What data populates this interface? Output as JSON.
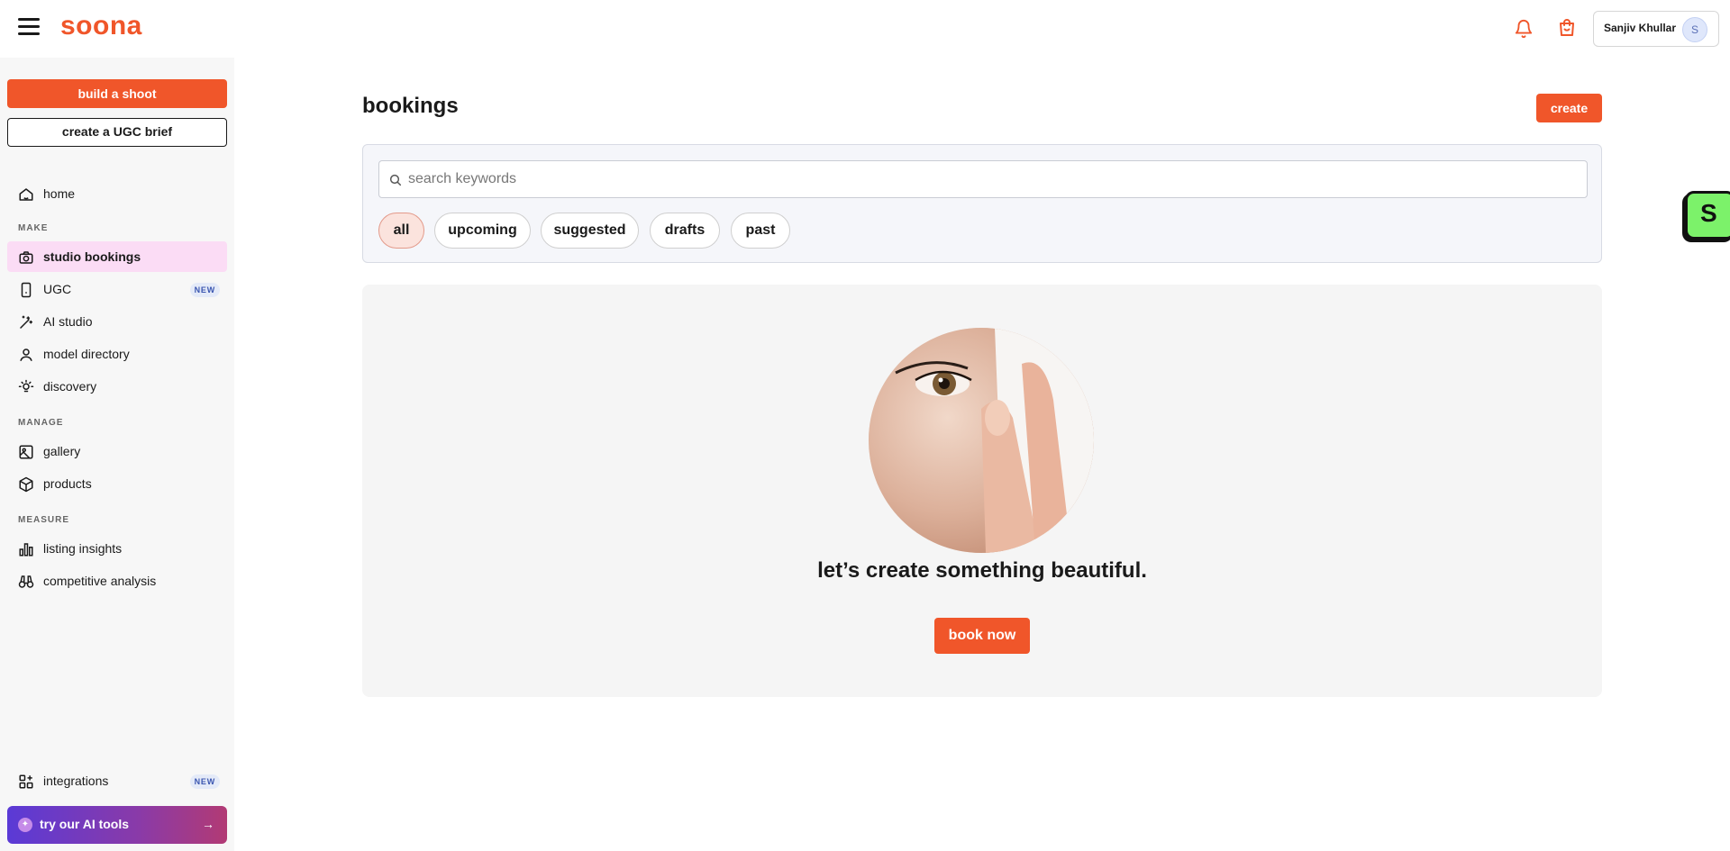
{
  "app": {
    "logo": "soona"
  },
  "header": {
    "user_name": "Sanjiv Khullar",
    "avatar_initial": "S"
  },
  "sidebar": {
    "build_shoot": "build a shoot",
    "create_ugc": "create a UGC brief",
    "home": "home",
    "sections": {
      "make": "MAKE",
      "manage": "MANAGE",
      "measure": "MEASURE"
    },
    "make_items": [
      {
        "label": "studio bookings",
        "active": true
      },
      {
        "label": "UGC",
        "badge": "NEW"
      },
      {
        "label": "AI studio"
      },
      {
        "label": "model directory"
      },
      {
        "label": "discovery"
      }
    ],
    "manage_items": [
      {
        "label": "gallery"
      },
      {
        "label": "products"
      }
    ],
    "measure_items": [
      {
        "label": "listing insights"
      },
      {
        "label": "competitive analysis"
      }
    ],
    "integrations": {
      "label": "integrations",
      "badge": "NEW"
    },
    "ai_tools": "try our AI tools"
  },
  "main": {
    "title": "bookings",
    "create_label": "create",
    "search": {
      "placeholder": "search keywords",
      "value": ""
    },
    "filters": [
      {
        "label": "all",
        "selected": true
      },
      {
        "label": "upcoming"
      },
      {
        "label": "suggested"
      },
      {
        "label": "drafts"
      },
      {
        "label": "past"
      }
    ],
    "empty_state": {
      "heading": "let’s create something beautiful.",
      "button": "book now"
    }
  },
  "side_widget": {
    "letter": "S"
  },
  "colors": {
    "accent": "#f0562a",
    "active_nav": "#fbdcf5",
    "widget": "#7cf26a"
  }
}
